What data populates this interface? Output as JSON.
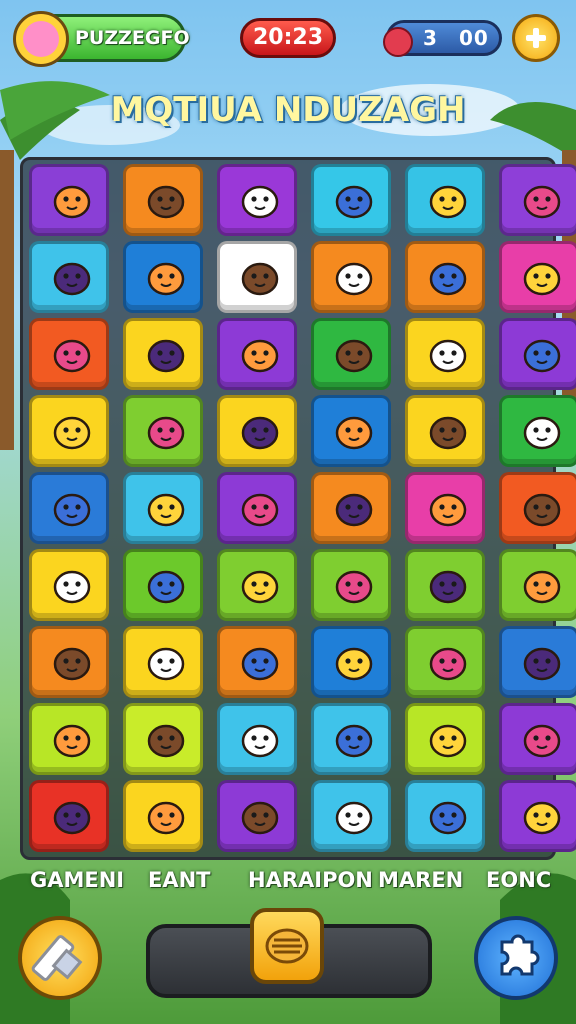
{
  "hud": {
    "player_name": "PUZZEGFO",
    "timer": "20:23",
    "currency_left": "3",
    "currency_right": "00",
    "avatar_icon": "pink-cat-face-icon",
    "gem_icon": "red-gem-icon",
    "add_icon": "plus-icon"
  },
  "title": "MQTIUA NDUZAGH",
  "board": {
    "columns": 6,
    "rows": 9,
    "tiles": [
      {
        "color": "#8a3fd6",
        "icon": "fox-icon"
      },
      {
        "color": "#f58a1f",
        "icon": "bear-icon"
      },
      {
        "color": "#9a38d8",
        "icon": "bird-icon"
      },
      {
        "color": "#35c7e8",
        "icon": "star-fish-icon"
      },
      {
        "color": "#36c3e6",
        "icon": "whale-icon"
      },
      {
        "color": "#8e3fd8",
        "icon": "ghost-cat-icon"
      },
      {
        "color": "#3fc3ea",
        "icon": "sun-creature-icon"
      },
      {
        "color": "#1f7fd8",
        "icon": "cat-head-icon"
      },
      {
        "color": "#ffffff",
        "icon": "backpack-icon"
      },
      {
        "color": "#f58a1f",
        "icon": "fish-icon"
      },
      {
        "color": "#f58a1f",
        "icon": "suitcase-icon"
      },
      {
        "color": "#e83ea8",
        "icon": "purple-creature-icon"
      },
      {
        "color": "#f25a22",
        "icon": "pig-icon"
      },
      {
        "color": "#fbd51f",
        "icon": "dog-icon"
      },
      {
        "color": "#8d3ad6",
        "icon": "diamond-gem-icon"
      },
      {
        "color": "#2fb841",
        "icon": "yellow-gem-icon"
      },
      {
        "color": "#fbd51f",
        "icon": "chick-icon"
      },
      {
        "color": "#8d3ad6",
        "icon": "squirrel-icon"
      },
      {
        "color": "#fbd51f",
        "icon": "fish-icon"
      },
      {
        "color": "#7fce30",
        "icon": "bear-icon"
      },
      {
        "color": "#fbd51f",
        "icon": "target-icon"
      },
      {
        "color": "#1f7fd8",
        "icon": "robot-icon"
      },
      {
        "color": "#fbd51f",
        "icon": "goldfish-icon"
      },
      {
        "color": "#2fb841",
        "icon": "puffer-fish-icon"
      },
      {
        "color": "#2a7bd8",
        "icon": "seal-icon"
      },
      {
        "color": "#3fc3ea",
        "icon": "seal-icon"
      },
      {
        "color": "#8d3ad6",
        "icon": "blob-icon"
      },
      {
        "color": "#f58a1f",
        "icon": "cat-head-icon"
      },
      {
        "color": "#e83ea8",
        "icon": "cloud-creature-icon"
      },
      {
        "color": "#f25a22",
        "icon": "bird-icon"
      },
      {
        "color": "#fbd51f",
        "icon": "radio-icon"
      },
      {
        "color": "#6cc92b",
        "icon": "frog-icon"
      },
      {
        "color": "#7fce30",
        "icon": "plus-badge-icon"
      },
      {
        "color": "#7fce30",
        "icon": "monkey-icon"
      },
      {
        "color": "#7fce30",
        "icon": "book-stack-icon"
      },
      {
        "color": "#7fce30",
        "icon": "scroll-icon"
      },
      {
        "color": "#f58a1f",
        "icon": "hamster-icon"
      },
      {
        "color": "#fbd51f",
        "icon": "fox-icon"
      },
      {
        "color": "#f58a1f",
        "icon": "cat-head-icon"
      },
      {
        "color": "#1f7fd8",
        "icon": "ladder-icon"
      },
      {
        "color": "#7fce30",
        "icon": "house-icon"
      },
      {
        "color": "#2a7bd8",
        "icon": "ghost-icon"
      },
      {
        "color": "#b8e626",
        "icon": "cone-icon"
      },
      {
        "color": "#c9ec2a",
        "icon": "cheese-icon"
      },
      {
        "color": "#3fc3ea",
        "icon": "owl-icon"
      },
      {
        "color": "#3fc3ea",
        "icon": "shield-icon"
      },
      {
        "color": "#b8e626",
        "icon": "turtle-icon"
      },
      {
        "color": "#8d3ad6",
        "icon": "squirrel-icon"
      },
      {
        "color": "#e83226",
        "icon": "chick-icon"
      },
      {
        "color": "#fbd51f",
        "icon": "dog-icon"
      },
      {
        "color": "#8d3ad6",
        "icon": "cat-head-icon"
      },
      {
        "color": "#3fc3ea",
        "icon": "backpack-icon"
      },
      {
        "color": "#3fc3ea",
        "icon": "carrot-icon"
      },
      {
        "color": "#8d3ad6",
        "icon": "waffle-icon"
      }
    ]
  },
  "categories": [
    "GAMENI",
    "EANT",
    "HARAIPON",
    "MAREN",
    "EONC"
  ],
  "tools": {
    "left_icon": "eraser-icon",
    "center_icon": "croissant-icon",
    "right_icon": "puzzle-piece-icon"
  }
}
